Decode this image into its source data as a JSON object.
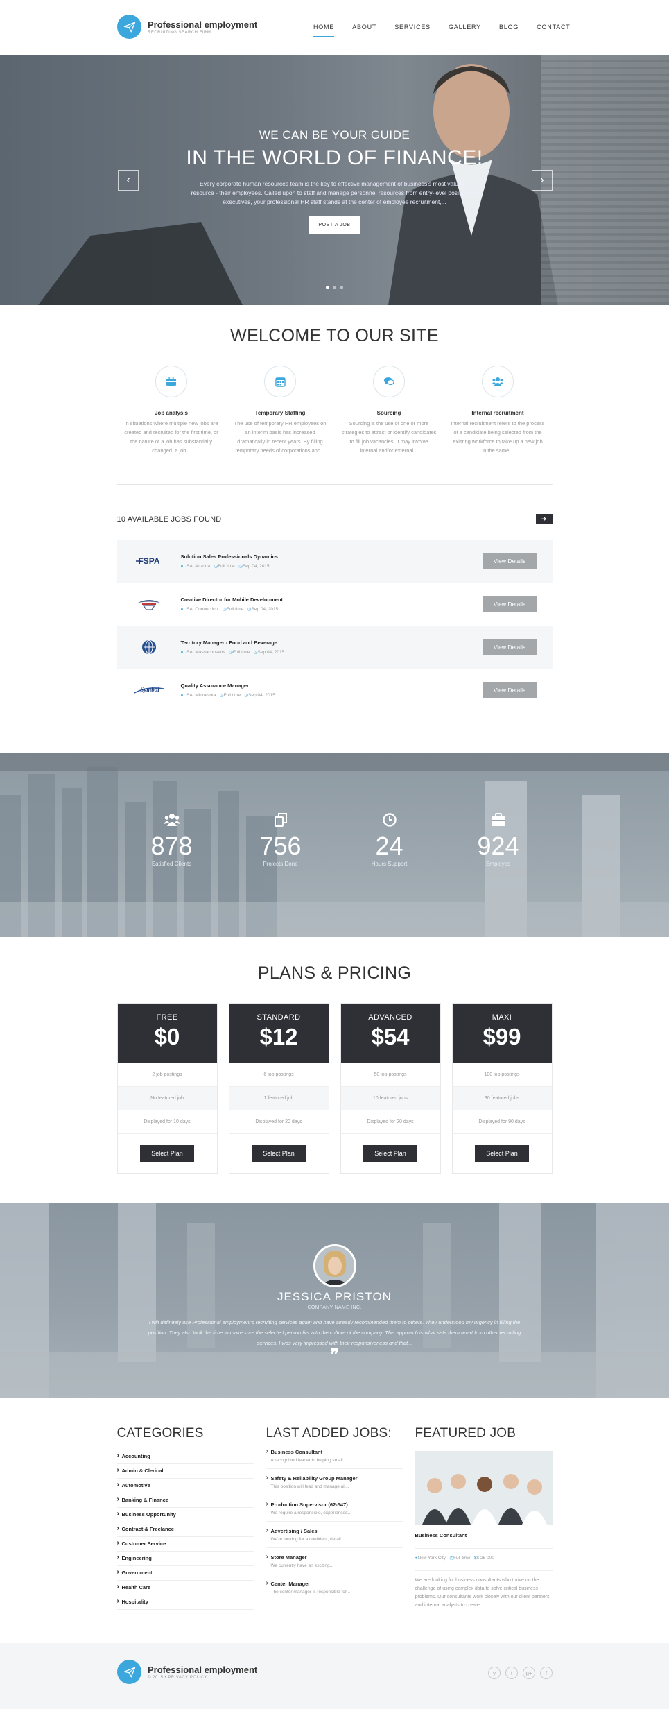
{
  "brand": {
    "name": "Professional employment",
    "tagline": "Recruiting search firm",
    "copyright": "© 2015 • Privacy Policy"
  },
  "nav": {
    "items": [
      "HOME",
      "ABOUT",
      "SERVICES",
      "GALLERY",
      "BLOG",
      "CONTACT"
    ],
    "active": "HOME"
  },
  "hero": {
    "pre_title": "WE CAN BE YOUR GUIDE",
    "title": "IN THE WORLD OF FINANCE!",
    "text": "Every corporate human resources team is the key to effective management of business's most valuable resource - their employees. Called upon to staff and manage personnel resources from entry-level positions to executives, your professional HR staff stands at the center of employee recruitment,...",
    "button": "POST A JOB",
    "prev_icon": "chevron-left-icon",
    "next_icon": "chevron-right-icon",
    "slides": 3,
    "active_slide": 1
  },
  "welcome": {
    "title": "WELCOME TO OUR SITE",
    "features": [
      {
        "icon": "briefcase-icon",
        "title": "Job analysis",
        "text": "In situations where multiple new jobs are created and recruited for the first time, or the nature of a job has substantially changed, a job..."
      },
      {
        "icon": "calendar-icon",
        "title": "Temporary Staffing",
        "text": "The use of temporary HR employees on an interim basis has increased dramatically in recent years. By filling temporary needs of corporations and..."
      },
      {
        "icon": "chat-icon",
        "title": "Sourcing",
        "text": "Sourcing is the use of one or more strategies to attract or identify candidates to fill job vacancies. It may involve internal and/or external..."
      },
      {
        "icon": "people-icon",
        "title": "Internal recruitment",
        "text": "Internal recruitment refers to the process of a candidate being selected from the existing workforce to take up a new job in the same..."
      }
    ]
  },
  "jobs": {
    "heading": "10 AVAILABLE JOBS FOUND",
    "button_label": "View Details",
    "items": [
      {
        "logo": "FSPA",
        "title": "Solution Sales Professionals Dynamics",
        "location": "USA, Arizona",
        "type": "Full time",
        "date": "Sep 04, 2015"
      },
      {
        "logo": "eagle-logo",
        "title": "Creative Director for Mobile Development",
        "location": "USA, Connecticut",
        "type": "Full time",
        "date": "Sep 04, 2015"
      },
      {
        "logo": "globe-logo",
        "title": "Territory Manager - Food and Beverage",
        "location": "USA, Massachusetts",
        "type": "Full time",
        "date": "Sep 04, 2015"
      },
      {
        "logo": "Symbol",
        "title": "Quality Assurance Manager",
        "location": "USA, Minnesota",
        "type": "Full time",
        "date": "Sep 04, 2015"
      }
    ]
  },
  "stats": [
    {
      "icon": "users-icon",
      "value": "878",
      "label": "Satisfied Clients"
    },
    {
      "icon": "copy-icon",
      "value": "756",
      "label": "Projects Done"
    },
    {
      "icon": "clock-icon",
      "value": "24",
      "label": "Hours Support"
    },
    {
      "icon": "briefcase-icon",
      "value": "924",
      "label": "Employes"
    }
  ],
  "pricing": {
    "title": "PLANS & PRICING",
    "button_label": "Select Plan",
    "plans": [
      {
        "name": "FREE",
        "price": "$0",
        "rows": [
          "2 job postings",
          "No featured job",
          "Displayed for 10 days"
        ]
      },
      {
        "name": "STANDARD",
        "price": "$12",
        "rows": [
          "6 job postings",
          "1 featured job",
          "Displayed for 20 days"
        ]
      },
      {
        "name": "ADVANCED",
        "price": "$54",
        "rows": [
          "50 job postings",
          "10 featured jobs",
          "Displayed for 20 days"
        ]
      },
      {
        "name": "MAXI",
        "price": "$99",
        "rows": [
          "100 job postings",
          "30 featured jobs",
          "Displayed for 90 days"
        ]
      }
    ]
  },
  "testimonial": {
    "name": "JESSICA PRISTON",
    "company": "COMPANY NAME INC.",
    "quote": "I will definitely use Professional employment's recruiting services again and have already recommended them to others. They understood my urgency in filling the position. They also took the time to make sure the selected person fits with the culture of the company. This approach is what sets them apart from other recruiting services. I was very impressed with their responsiveness and that..."
  },
  "categories": {
    "title": "CATEGORIES",
    "items": [
      "Accounting",
      "Admin & Clerical",
      "Automotive",
      "Banking & Finance",
      "Business Opportunity",
      "Contract & Freelance",
      "Customer Service",
      "Engineering",
      "Government",
      "Health Care",
      "Hospitality"
    ]
  },
  "last_jobs": {
    "title": "LAST ADDED JOBS:",
    "items": [
      {
        "title": "Business Consultant",
        "desc": "A recognized leader in helping small..."
      },
      {
        "title": "Safety & Reliability Group Manager",
        "desc": "This position will lead and manage all..."
      },
      {
        "title": "Production Supervisor (62-547)",
        "desc": "We require a responsible, experienced..."
      },
      {
        "title": "Advertising / Sales",
        "desc": "We're looking for a confident, detail..."
      },
      {
        "title": "Store Manager",
        "desc": "We currently have an exciting..."
      },
      {
        "title": "Center Manager",
        "desc": "The center manager is responsible for..."
      }
    ]
  },
  "featured": {
    "title": "FEATURED JOB",
    "job_title": "Business Consultant",
    "location": "New York City",
    "type": "Full time",
    "salary": "$ 25 000",
    "text": "We are looking for business consultants who thrive on the challenge of using complex data to solve critical business problems. Our consultants work closely with our client partners and internal analysts to create..."
  },
  "footer": {
    "social": [
      "y",
      "t",
      "g+",
      "f"
    ]
  },
  "colors": {
    "accent": "#3ba7dd",
    "dark": "#2e3035",
    "muted": "#999999"
  }
}
